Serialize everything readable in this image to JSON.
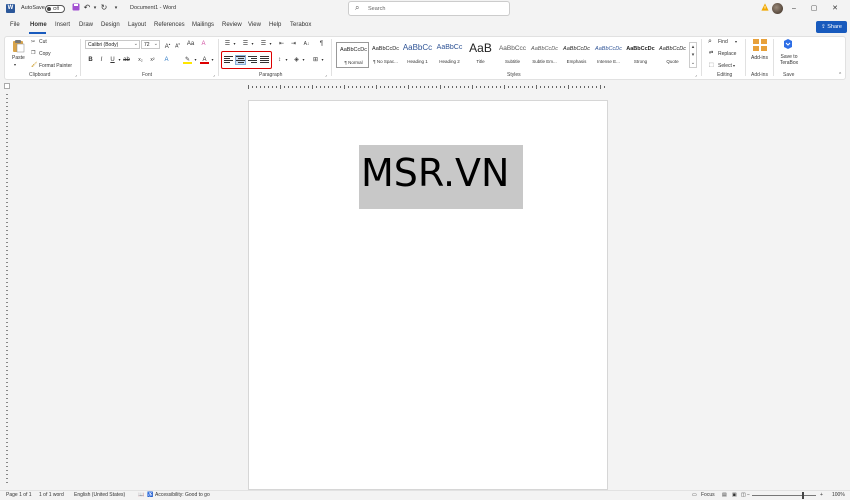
{
  "titlebar": {
    "autosave_label": "AutoSave",
    "autosave_state": "Off",
    "doc_title": "Document1 - Word",
    "search_placeholder": "Search",
    "min_symbol": "–",
    "max_symbol": "▢",
    "close_symbol": "✕"
  },
  "tabs": [
    "File",
    "Home",
    "Insert",
    "Draw",
    "Design",
    "Layout",
    "References",
    "Mailings",
    "Review",
    "View",
    "Help",
    "Terabox"
  ],
  "active_tab": "Home",
  "share_label": "Share",
  "ribbon": {
    "clipboard": {
      "paste": "Paste",
      "cut": "Cut",
      "copy": "Copy",
      "format_painter": "Format Painter",
      "group": "Clipboard"
    },
    "font": {
      "family": "Calibri (Body)",
      "size": "72",
      "group": "Font"
    },
    "paragraph": {
      "group": "Paragraph"
    },
    "styles": {
      "group": "Styles",
      "items": [
        {
          "preview": "AaBbCcDc",
          "name": "¶ Normal"
        },
        {
          "preview": "AaBbCcDc",
          "name": "¶ No Spac..."
        },
        {
          "preview": "AaBbCc",
          "name": "Heading 1"
        },
        {
          "preview": "AaBbCc",
          "name": "Heading 2"
        },
        {
          "preview": "AaB",
          "name": "Title"
        },
        {
          "preview": "AaBbCcc",
          "name": "Subtitle"
        },
        {
          "preview": "AaBbCcDc",
          "name": "Subtle Em..."
        },
        {
          "preview": "AaBbCcDc",
          "name": "Emphasis"
        },
        {
          "preview": "AaBbCcDc",
          "name": "Intense E..."
        },
        {
          "preview": "AaBbCcDc",
          "name": "Strong"
        },
        {
          "preview": "AaBbCcDc",
          "name": "Quote"
        }
      ]
    },
    "editing": {
      "find": "Find",
      "replace": "Replace",
      "select": "Select",
      "group": "Editing"
    },
    "addins": {
      "label": "Add-ins",
      "group": "Add-ins"
    },
    "save": {
      "label": "Save to TeraBox",
      "group": "Save"
    }
  },
  "document": {
    "text": "MSR.VN"
  },
  "status": {
    "page": "Page 1 of 1",
    "words": "1 of 1 word",
    "language": "English (United States)",
    "accessibility": "Accessibility: Good to go",
    "focus": "Focus",
    "zoom": "100%"
  },
  "colors": {
    "accent": "#185abd",
    "word_blue": "#2b579a",
    "highlight": "#c8c8c8",
    "annotation_red": "#dd0000"
  }
}
